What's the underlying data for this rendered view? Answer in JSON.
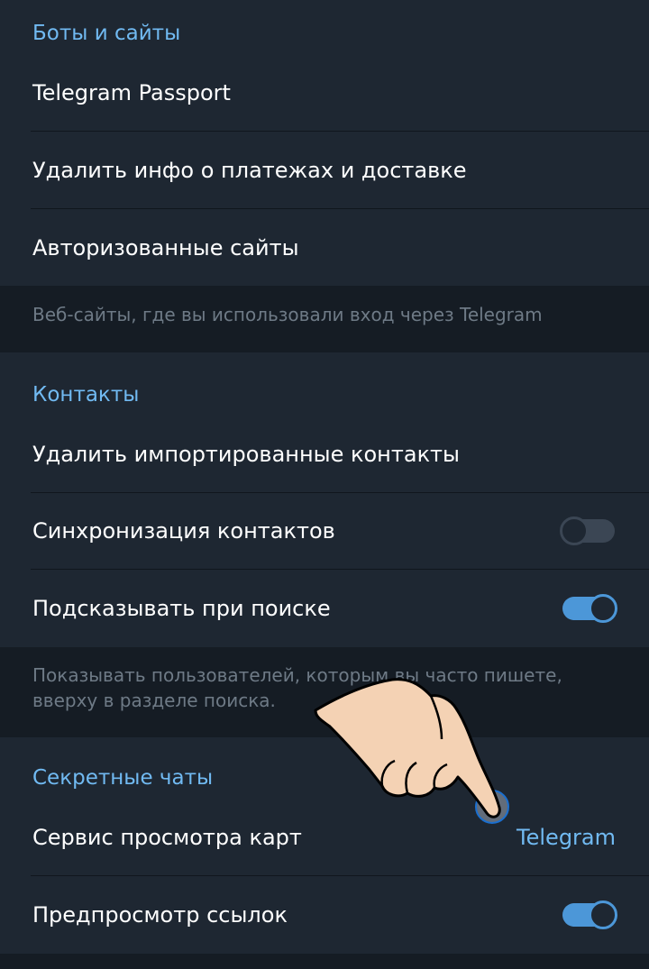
{
  "bots_section": {
    "header": "Боты и сайты",
    "items": [
      {
        "label": "Telegram Passport"
      },
      {
        "label": "Удалить инфо о платежах и доставке"
      },
      {
        "label": "Авторизованные сайты"
      }
    ],
    "info": "Веб-сайты, где вы использовали вход через Telegram"
  },
  "contacts_section": {
    "header": "Контакты",
    "items": [
      {
        "label": "Удалить импортированные контакты"
      },
      {
        "label": "Синхронизация контактов",
        "toggle": false
      },
      {
        "label": "Подсказывать при поиске",
        "toggle": true
      }
    ],
    "info": "Показывать пользователей, которым вы часто пишете, вверху в разделе поиска."
  },
  "secret_section": {
    "header": "Секретные чаты",
    "items": [
      {
        "label": "Сервис просмотра карт",
        "value": "Telegram"
      },
      {
        "label": "Предпросмотр ссылок",
        "toggle": true
      }
    ]
  },
  "colors": {
    "background": "#151c24",
    "section": "#1e2732",
    "accent": "#71baf2",
    "toggle_on": "#4c97d8",
    "toggle_off": "#3b4654"
  }
}
